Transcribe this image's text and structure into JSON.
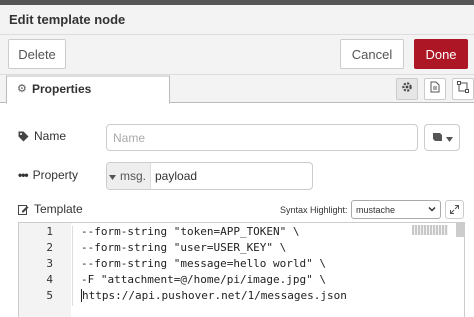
{
  "dialog": {
    "title": "Edit template node"
  },
  "buttons": {
    "delete": "Delete",
    "cancel": "Cancel",
    "done": "Done"
  },
  "tabs": {
    "properties": "Properties"
  },
  "form": {
    "name_label": "Name",
    "name_placeholder": "Name",
    "property_label": "Property",
    "property_prefix": "msg.",
    "property_value": "payload",
    "template_label": "Template",
    "syntax_label": "Syntax Highlight:",
    "syntax_value": "mustache"
  },
  "editor": {
    "lines": [
      {
        "num": "1",
        "text": "--form-string \"token=APP_TOKEN\" \\"
      },
      {
        "num": "2",
        "text": "--form-string \"user=USER_KEY\" \\"
      },
      {
        "num": "3",
        "text": "--form-string \"message=hello world\" \\"
      },
      {
        "num": "4",
        "text": "-F \"attachment=@/home/pi/image.jpg\" \\"
      },
      {
        "num": "5",
        "text": "https://api.pushover.net/1/messages.json"
      }
    ]
  },
  "colors": {
    "done_button": "#ad1625",
    "header_bg": "#f3f3f3",
    "gutter_bg": "#f3f3f3"
  },
  "icons": [
    "gear-icon",
    "document-icon",
    "frame-icon",
    "tag-icon",
    "ellipsis-icon",
    "book-icon",
    "chevron-down-icon",
    "edit-icon",
    "expand-icon"
  ]
}
